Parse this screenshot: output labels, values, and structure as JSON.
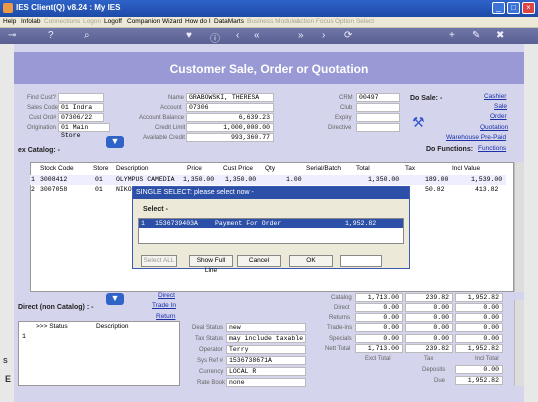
{
  "window": {
    "title": "IES Client(Q) v8.24 : My IES"
  },
  "menu": [
    "Help",
    "Infolab",
    "Connections",
    "Logon",
    "Logoff",
    "Companion",
    "Wizard",
    "How do I",
    "DataMarts",
    "Business Modules",
    "Action Focus",
    "Option Select"
  ],
  "page": {
    "title": "Customer Sale, Order or Quotation"
  },
  "left_fields": {
    "find_cust_label": "Find Cust?",
    "sales_code_label": "Sales Code",
    "sales_code": "01 Indra",
    "cust_ord_label": "Cust Ord#",
    "cust_ord": "07306/22",
    "origination_label": "Origination",
    "origination": "01 Main Store"
  },
  "mid_fields": {
    "name_label": "Name",
    "name": "GRABOWSKI, THERESA",
    "account_label": "Account",
    "account": "07306",
    "account_balance_label": "Account Balance",
    "account_balance": "6,639.23",
    "credit_limit_label": "Credit Limit",
    "credit_limit": "1,000,000.00",
    "available_credit_label": "Available Credit",
    "available_credit": "993,360.77"
  },
  "right_fields": {
    "crm_label": "CRM",
    "crm": "00497",
    "club_label": "Club",
    "expiry_label": "Expiry",
    "directive_label": "Directive"
  },
  "do_sale": {
    "label": "Do Sale: -",
    "links": [
      "Cashier",
      "Sale",
      "Order",
      "Quotation",
      "Warehouse Pre-Paid"
    ]
  },
  "do_functions": {
    "label": "Do Functions:",
    "link": "Functions"
  },
  "ex_catalog": {
    "label": "ex Catalog: -"
  },
  "grid": {
    "headers": [
      "Stock Code",
      "Store",
      "Description",
      "Price",
      "Cust Price",
      "Qty",
      "Serial/Batch",
      "Total",
      "Tax",
      "Incl Value"
    ],
    "rows": [
      {
        "n": "1",
        "stock": "3008412",
        "store": "01",
        "desc": "OLYMPUS CAMEDIA",
        "price": "1,350.00",
        "cust": "1,350.00",
        "qty": "1.00",
        "serial": "",
        "total": "1,350.00",
        "tax": "189.00",
        "incl": "1,539.00"
      },
      {
        "n": "2",
        "stock": "3007058",
        "store": "01",
        "desc": "NIKO",
        "price": "",
        "cust": "",
        "qty": "",
        "serial": "",
        "total": "",
        "tax": "50.82",
        "incl": "413.82"
      }
    ]
  },
  "dialog": {
    "title": "SINGLE SELECT: please select now -",
    "heading": "Select -",
    "item": {
      "n": "1",
      "code": "1536739403A",
      "desc": "Payment For Order",
      "amount": "1,952.82"
    },
    "buttons": {
      "select_all": "Select ALL",
      "show_full": "Show Full Line",
      "cancel": "Cancel",
      "ok": "OK"
    }
  },
  "direct": {
    "label": "Direct (non Catalog) : -",
    "links": [
      "Direct",
      "Trade In",
      "Return"
    ]
  },
  "bottom_grid": {
    "headers": [
      ">>> Status",
      "Description"
    ],
    "row_n": "1"
  },
  "deal": {
    "deal_status_label": "Deal Status",
    "deal_status": "new",
    "tax_status_label": "Tax Status",
    "tax_status": "may include taxable and",
    "operator_label": "Operator",
    "operator": "Terry",
    "sys_ref_label": "Sys Ref #",
    "sys_ref": "1536738671A",
    "currency_label": "Currency",
    "currency": "LOCAL R",
    "rate_book_label": "Rate Book",
    "rate_book": "none"
  },
  "totals": {
    "rows": [
      {
        "label": "Catalog",
        "a": "1,713.00",
        "b": "239.82",
        "c": "1,952.82"
      },
      {
        "label": "Direct",
        "a": "0.00",
        "b": "0.00",
        "c": "0.00"
      },
      {
        "label": "Returns",
        "a": "0.00",
        "b": "0.00",
        "c": "0.00"
      },
      {
        "label": "Trade-ins",
        "a": "0.00",
        "b": "0.00",
        "c": "0.00"
      },
      {
        "label": "Specials",
        "a": "0.00",
        "b": "0.00",
        "c": "0.00"
      },
      {
        "label": "Nett Total",
        "a": "1,713.00",
        "b": "239.82",
        "c": "1,952.82"
      }
    ],
    "excl_label": "Excl Total",
    "tax_label": "Tax",
    "incl_label": "Incl Total",
    "deposits_label": "Deposits",
    "deposits": "0.00",
    "due_label": "Due",
    "due": "1,952.82"
  },
  "side_letters": {
    "left_s": "S",
    "left_e": "E"
  }
}
